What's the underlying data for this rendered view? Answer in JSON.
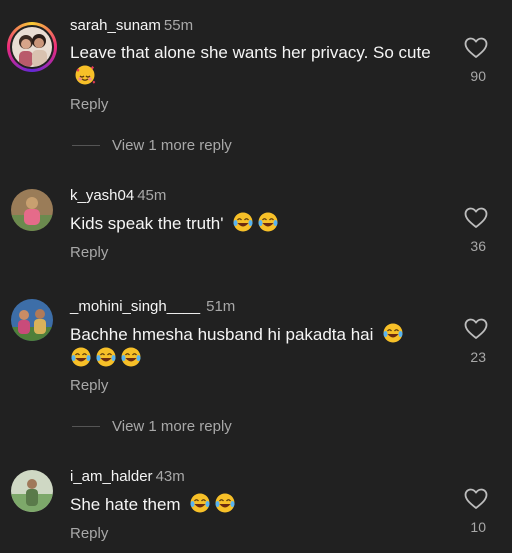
{
  "comments": [
    {
      "username": "sarah_sunam",
      "time": "55m",
      "text": "Leave that alone she wants her privacy. So cute",
      "emojis": [
        "smiling-face-with-hearts"
      ],
      "reply_label": "Reply",
      "likes": "90",
      "view_more": "View 1 more reply",
      "has_story_ring": true,
      "avatar_colors": [
        "#8a5a44",
        "#d7a58a",
        "#f0e6dc"
      ]
    },
    {
      "username": "k_yash04",
      "time": "45m",
      "text": "Kids speak the truth'",
      "emojis": [
        "face-with-tears-of-joy",
        "face-with-tears-of-joy"
      ],
      "reply_label": "Reply",
      "likes": "36",
      "has_story_ring": false,
      "avatar_colors": [
        "#c8a070",
        "#e56b8a",
        "#6b8a4e"
      ]
    },
    {
      "username": "_mohini_singh____",
      "time": "51m",
      "text": "Bachhe hmesha husband hi pakadta hai",
      "emojis": [
        "face-with-tears-of-joy",
        "face-with-tears-of-joy",
        "face-with-tears-of-joy",
        "face-with-tears-of-joy"
      ],
      "reply_label": "Reply",
      "likes": "23",
      "view_more": "View 1 more reply",
      "has_story_ring": false,
      "avatar_colors": [
        "#3d6ea8",
        "#c94b7a",
        "#d8b25a"
      ]
    },
    {
      "username": "i_am_halder",
      "time": "43m",
      "text": "She hate them",
      "emojis": [
        "face-with-tears-of-joy",
        "face-with-tears-of-joy"
      ],
      "reply_label": "Reply",
      "likes": "10",
      "has_story_ring": false,
      "avatar_colors": [
        "#7da86a",
        "#cfd8c4",
        "#5a7a4a"
      ]
    }
  ],
  "icons": {
    "like": "heart-outline-icon"
  },
  "colors": {
    "background": "#212121",
    "primary_text": "#f5f5f5",
    "secondary_text": "#a8a8a8"
  }
}
